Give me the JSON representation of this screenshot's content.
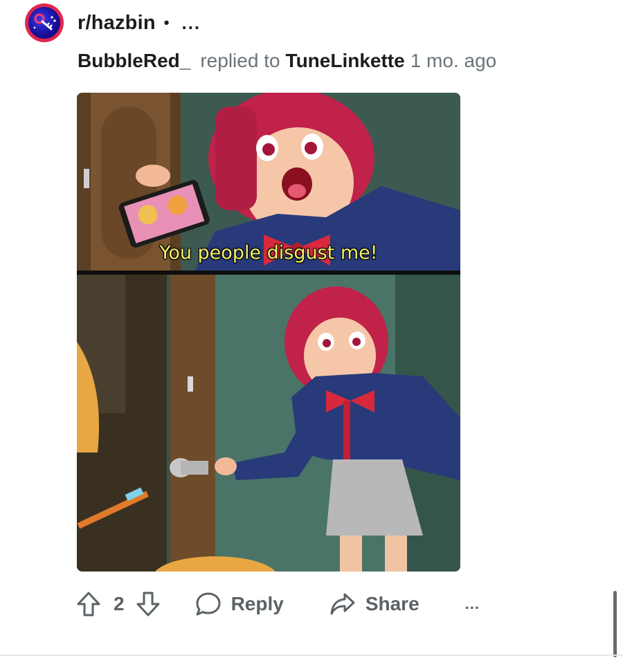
{
  "post": {
    "subreddit": "r/hazbin",
    "separator": "•",
    "more_label": "...",
    "author": "BubbleRed_",
    "replied_to_label": "replied to",
    "replied_to_user": "TuneLinkette",
    "time_ago": "1 mo. ago"
  },
  "image": {
    "caption": "You people disgust me!"
  },
  "actions": {
    "vote_count": "2",
    "reply_label": "Reply",
    "share_label": "Share",
    "more_label": "..."
  },
  "icons": {
    "upvote": "arrow-up-icon",
    "downvote": "arrow-down-icon",
    "reply": "speech-bubble-icon",
    "share": "share-arrow-icon"
  },
  "colors": {
    "avatar_ring": "#e0254f",
    "muted_text": "#6a7378",
    "caption_text": "#f4f16a"
  }
}
